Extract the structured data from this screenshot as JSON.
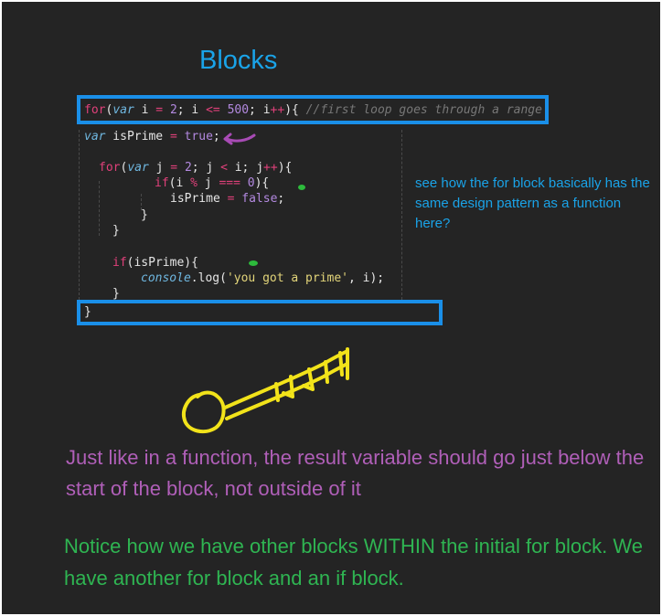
{
  "title": "Blocks",
  "code": {
    "line1": {
      "k_for": "for",
      "p1": "(",
      "k_var": "var",
      "p2": " i ",
      "eq": "=",
      "sp1": " ",
      "n2": "2",
      "p3": "; i ",
      "le": "<=",
      "sp2": " ",
      "n500": "500",
      "p4": "; i",
      "inc": "++",
      "p5": "){ ",
      "comment": "//first loop goes through a range"
    },
    "line2": {
      "k_var": "var",
      "p1": " isPrime ",
      "eq": "=",
      "sp1": " ",
      "val": "true",
      "p2": ";"
    },
    "line3": {
      "k_for": "for",
      "p1": "(",
      "k_var": "var",
      "p2": " j ",
      "eq": "=",
      "sp1": " ",
      "n2": "2",
      "p3": "; j ",
      "lt": "<",
      "p4": " i; j",
      "inc": "++",
      "p5": "){"
    },
    "line4": {
      "k_if": "if",
      "p1": "(i ",
      "mod": "%",
      "p2": " j ",
      "seq": "===",
      "sp1": " ",
      "n0": "0",
      "p3": "){"
    },
    "line5": {
      "p1": "isPrime ",
      "eq": "=",
      "sp1": " ",
      "val": "false",
      "p2": ";"
    },
    "line6": "}",
    "line7": "}",
    "line8": {
      "k_if": "if",
      "p1": "(isPrime){"
    },
    "line9": {
      "obj": "console",
      "p1": ".log(",
      "str": "'you got a prime'",
      "p2": ", i);"
    },
    "line10": "}",
    "line11": "}"
  },
  "notes": {
    "blue": "see how the for block basically has the same design pattern as a function here?",
    "purple": "Just like in a function, the result variable should go just below the start of the block, not outside of it",
    "green": "Notice how we have other blocks WITHIN the initial for block. We have another for block and an if block."
  },
  "colors": {
    "background": "#242424",
    "box": "#1a8fe8",
    "key": "#f2e31a",
    "arrow": "#a84bb5",
    "dot": "#2dbb3c",
    "title": "#1aa3e8",
    "purple_note": "#b05fb8",
    "green_note": "#2fb552"
  },
  "icons": [
    "key-drawing-icon",
    "curved-arrow-icon",
    "green-dot-icon"
  ]
}
